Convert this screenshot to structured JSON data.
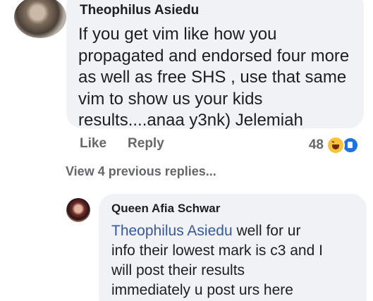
{
  "comment": {
    "author": "Theophilus Asiedu",
    "lines": [
      "If you get vim like how you",
      "propagated and endorsed four more",
      "as well as free SHS , use that same",
      "vim to show us your kids",
      "results....anaa y3nk) Jelemiah"
    ],
    "like_label": "Like",
    "reply_label": "Reply",
    "reaction_count": "48",
    "reaction_icons": [
      "haha-icon",
      "like-icon"
    ]
  },
  "view_previous_replies": "View 4 previous replies...",
  "reply": {
    "author": "Queen Afia Schwar",
    "mention": "Theophilus Asiedu",
    "first_line_rest": " well for ur",
    "lines": [
      "info their lowest mark is c3 and I",
      "will post their results",
      "immediately u post urs here"
    ]
  },
  "colors": {
    "bubble": "#f0f2f5",
    "mention": "#385898",
    "secondary_text": "#65676b",
    "like_blue": "#1b74e4",
    "haha_yellow": "#f7c33c"
  }
}
